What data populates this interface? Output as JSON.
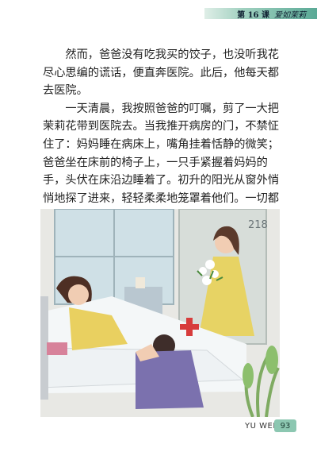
{
  "header": {
    "lesson_number": "第 16 课",
    "lesson_title": "爱如茉莉"
  },
  "body": {
    "paragraphs": [
      "然而，爸爸没有吃我买的饺子，也没听我花尽心思编的谎话，便直奔医院。此后，他每天都去医院。",
      "一天清晨，我按照爸爸的叮嘱，剪了一大把茉莉花带到医院去。当我推开病房的门，不禁怔住了：妈妈睡在病床上，嘴角挂着恬静的微笑；爸爸坐在床前的椅子上，一只手紧握着妈妈的手，头伏在床沿边睡着了。初升的阳光从窗外悄悄地探了进来，轻轻柔柔地笼罩着他们。一切都"
    ]
  },
  "illustration": {
    "wall_number": "218"
  },
  "footer": {
    "label": "YU WEN",
    "page_number": "93"
  },
  "colors": {
    "accent": "#8cc7b1",
    "header_band": "#5aa996"
  }
}
